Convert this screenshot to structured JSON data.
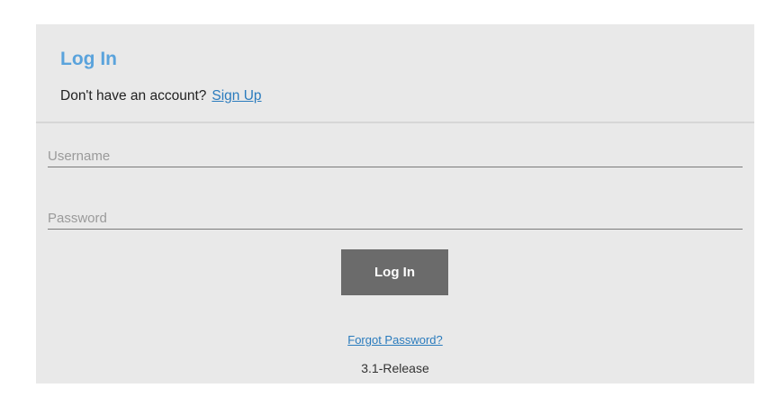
{
  "login_panel": {
    "title": "Log In",
    "signup_prompt": "Don't have an account?",
    "signup_link": "Sign Up",
    "username": {
      "placeholder": "Username",
      "value": ""
    },
    "password": {
      "placeholder": "Password",
      "value": ""
    },
    "login_button": "Log In",
    "forgot_password": "Forgot Password?",
    "version": "3.1-Release"
  },
  "colors": {
    "title": "#5aa3dc",
    "link": "#2a7bbd",
    "panel_background": "#e9e9e9",
    "button_background": "#6b6b6b"
  }
}
